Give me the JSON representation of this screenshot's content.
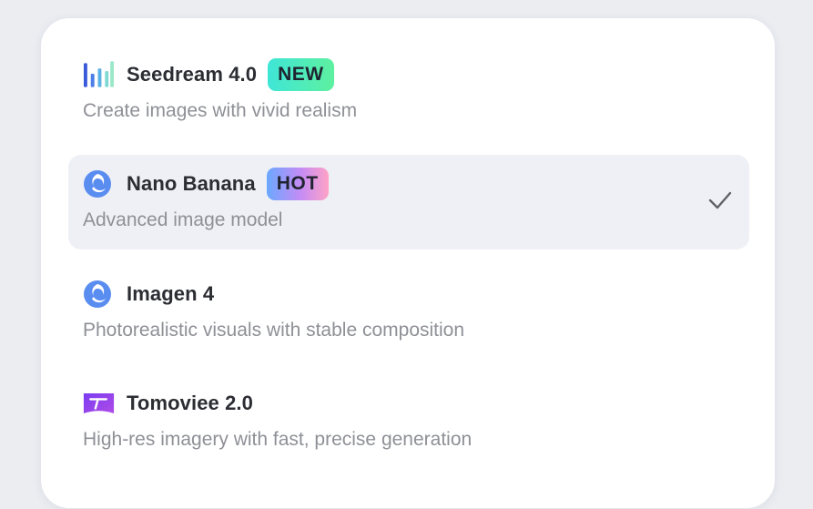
{
  "model_menu": {
    "options": [
      {
        "name": "Seedream 4.0",
        "badge": "NEW",
        "description": "Create images with vivid realism",
        "icon": "seedream-logo-icon",
        "selected": false
      },
      {
        "name": "Nano Banana",
        "badge": "HOT",
        "description": "Advanced image model",
        "icon": "nano-banana-logo-icon",
        "selected": true
      },
      {
        "name": "Imagen 4",
        "badge": "",
        "description": "Photorealistic visuals with stable composition",
        "icon": "imagen-logo-icon",
        "selected": false
      },
      {
        "name": "Tomoviee 2.0",
        "badge": "",
        "description": "High-res imagery with fast, precise generation",
        "icon": "tomoviee-logo-icon",
        "selected": false
      }
    ]
  },
  "colors": {
    "selected_bg": "#eef0f5",
    "new_badge": "#3fe6d7",
    "hot_badge": "#c58cf5",
    "title_text": "#2b2d33",
    "desc_text": "#8e9096"
  }
}
